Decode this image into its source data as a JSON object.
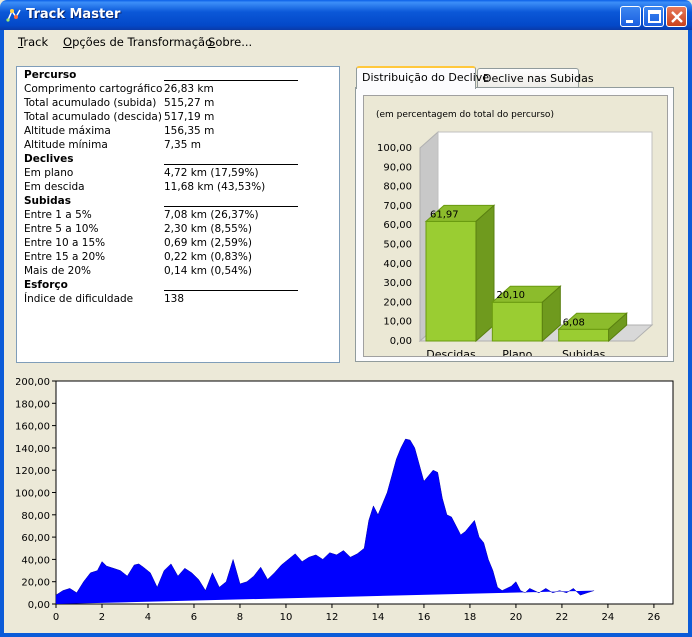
{
  "window": {
    "title": "Track Master"
  },
  "menu": [
    {
      "accel": "T",
      "rest": "rack"
    },
    {
      "accel": "O",
      "rest": "pções de Transformação"
    },
    {
      "accel": "S",
      "rest": "obre..."
    }
  ],
  "stats": {
    "percurso": {
      "heading": "Percurso",
      "rows": [
        {
          "label": "Comprimento cartográfico",
          "value": "26,83 km"
        },
        {
          "label": "Total acumulado (subida)",
          "value": "515,27 m"
        },
        {
          "label": "Total acumulado (descida)",
          "value": "517,19 m"
        },
        {
          "label": "Altitude máxima",
          "value": "156,35 m"
        },
        {
          "label": "Altitude mínima",
          "value": "7,35 m"
        }
      ]
    },
    "declives": {
      "heading": "Declives",
      "rows": [
        {
          "label": "Em plano",
          "value": "4,72 km (17,59%)"
        },
        {
          "label": "Em descida",
          "value": "11,68 km (43,53%)"
        }
      ]
    },
    "subidas": {
      "heading": "Subidas",
      "rows": [
        {
          "label": "Entre 1 a 5%",
          "value": "7,08 km (26,37%)"
        },
        {
          "label": "Entre 5 a 10%",
          "value": "2,30 km (8,55%)"
        },
        {
          "label": "Entre 10 a 15%",
          "value": "0,69 km (2,59%)"
        },
        {
          "label": "Entre 15 a 20%",
          "value": "0,22 km (0,83%)"
        },
        {
          "label": "Mais de 20%",
          "value": "0,14 km (0,54%)"
        }
      ]
    },
    "esforco": {
      "heading": "Esforço",
      "rows": [
        {
          "label": "Índice de dificuldade",
          "value": "138"
        }
      ]
    }
  },
  "tabs": [
    {
      "label": "Distribuição do Declive",
      "active": true
    },
    {
      "label": "Declive nas Subidas",
      "active": false
    }
  ],
  "colors": {
    "bar": "#9acd32",
    "elevation_fill": "#0000ff",
    "titlebar": "#0a5fe8"
  },
  "chart_data": [
    {
      "type": "bar",
      "subtitle": "(em percentagem do total do percurso)",
      "categories": [
        "Descidas",
        "Plano",
        "Subidas"
      ],
      "values": [
        61.97,
        20.1,
        6.08
      ],
      "value_labels": [
        "61,97",
        "20,10",
        "6,08"
      ],
      "ylim": [
        0,
        100
      ],
      "yticks": [
        "0,00",
        "10,00",
        "20,00",
        "30,00",
        "40,00",
        "50,00",
        "60,00",
        "70,00",
        "80,00",
        "90,00",
        "100,00"
      ],
      "style": "3d"
    },
    {
      "type": "area",
      "xlim": [
        0,
        26.83
      ],
      "ylim": [
        0,
        200
      ],
      "xticks": [
        "0",
        "2",
        "4",
        "6",
        "8",
        "10",
        "12",
        "14",
        "16",
        "18",
        "20",
        "22",
        "24",
        "26"
      ],
      "yticks": [
        "0,00",
        "20,00",
        "40,00",
        "60,00",
        "80,00",
        "100,00",
        "120,00",
        "140,00",
        "160,00",
        "180,00",
        "200,00"
      ],
      "x": [
        0,
        0.3,
        0.6,
        0.9,
        1.2,
        1.5,
        1.8,
        2.0,
        2.2,
        2.5,
        2.8,
        3.1,
        3.4,
        3.6,
        3.8,
        4.1,
        4.4,
        4.7,
        5.0,
        5.3,
        5.6,
        5.9,
        6.2,
        6.5,
        6.8,
        7.1,
        7.4,
        7.7,
        8.0,
        8.3,
        8.6,
        8.9,
        9.2,
        9.5,
        9.8,
        10.1,
        10.4,
        10.7,
        11.0,
        11.3,
        11.6,
        11.9,
        12.2,
        12.5,
        12.8,
        13.1,
        13.4,
        13.6,
        13.8,
        14.0,
        14.2,
        14.4,
        14.6,
        14.8,
        15.0,
        15.2,
        15.4,
        15.6,
        15.8,
        16.0,
        16.2,
        16.4,
        16.6,
        16.8,
        17.0,
        17.2,
        17.4,
        17.6,
        17.8,
        18.0,
        18.2,
        18.4,
        18.6,
        18.8,
        19.0,
        19.2,
        19.4,
        19.6,
        19.8,
        20.0,
        20.2,
        20.4,
        20.6,
        20.8,
        21.0,
        21.3,
        21.6,
        21.9,
        22.2,
        22.5,
        22.8,
        23.1,
        23.4,
        23.7,
        24.0,
        24.3,
        24.6,
        24.9,
        25.2,
        25.5,
        25.8,
        26.1,
        26.4,
        26.83
      ],
      "y": [
        8,
        12,
        14,
        10,
        20,
        28,
        30,
        38,
        34,
        32,
        30,
        25,
        35,
        36,
        33,
        28,
        15,
        30,
        36,
        25,
        32,
        28,
        22,
        12,
        28,
        15,
        20,
        40,
        18,
        20,
        25,
        33,
        22,
        28,
        35,
        40,
        45,
        38,
        42,
        44,
        40,
        46,
        44,
        48,
        42,
        45,
        50,
        75,
        88,
        80,
        90,
        100,
        115,
        130,
        140,
        148,
        147,
        140,
        125,
        110,
        115,
        120,
        118,
        95,
        80,
        78,
        70,
        62,
        65,
        70,
        75,
        60,
        55,
        40,
        30,
        15,
        12,
        14,
        16,
        20,
        12,
        10,
        14,
        12,
        10,
        14,
        10,
        12,
        10,
        14,
        8,
        10,
        12
      ],
      "fill": "#0000ff"
    }
  ]
}
